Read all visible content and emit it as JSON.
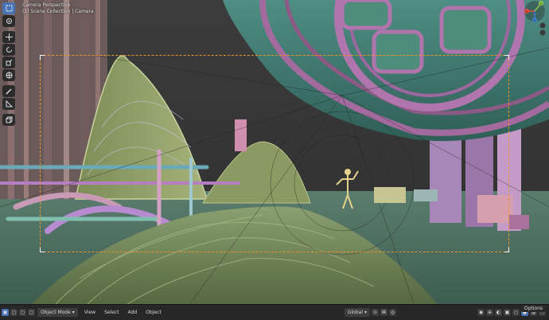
{
  "viewport": {
    "view_name": "Camera Perspective",
    "collection_path": "(1) Scene Collection | Camera"
  },
  "toolbar": {
    "tools": [
      "select-box-icon",
      "cursor-icon",
      "move-icon",
      "rotate-icon",
      "scale-icon",
      "transform-icon",
      "annotate-icon",
      "measure-icon",
      "add-cube-icon"
    ]
  },
  "navigation": {
    "axis_labels": [
      "Y",
      "X",
      "Z"
    ]
  },
  "header": {
    "mode_label": "Object Mode",
    "menus": [
      "View",
      "Select",
      "Add",
      "Object"
    ],
    "transform_orientation": "Global",
    "options_label": "Options"
  },
  "colors": {
    "accent": "#4772b3",
    "camera_frame": "#e8932e",
    "background": "#1d1d1d"
  }
}
